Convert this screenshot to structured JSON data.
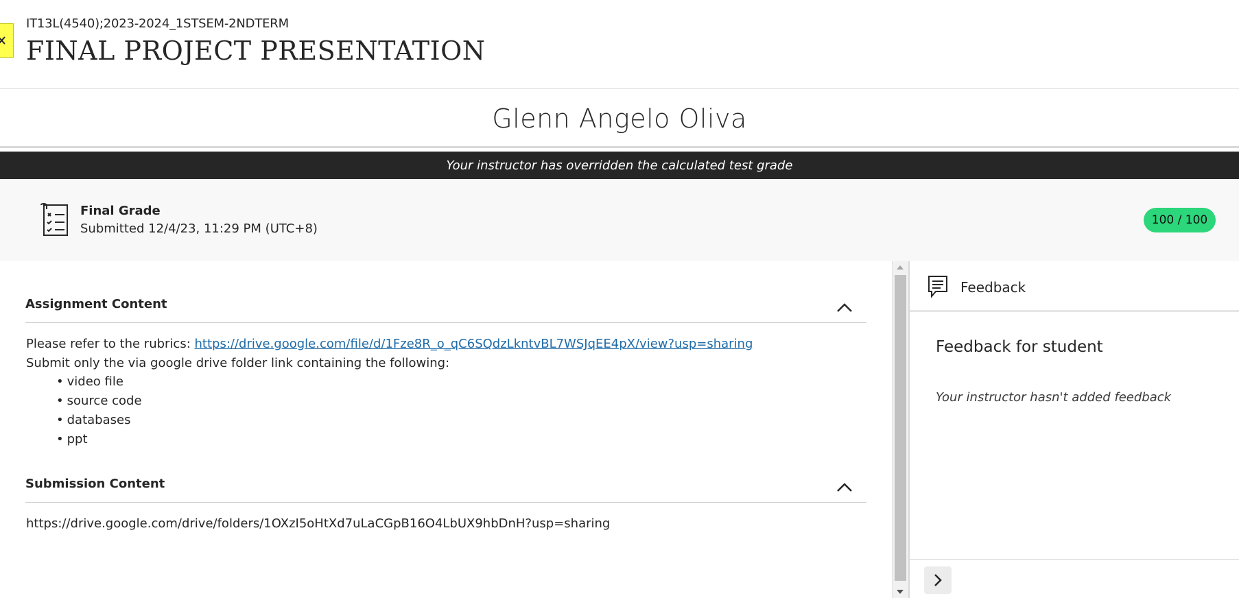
{
  "header": {
    "course_id": "IT13L(4540);2023-2024_1STSEM-2NDTERM",
    "title": "FINAL PROJECT PRESENTATION",
    "close_icon": "close-x-icon"
  },
  "student": {
    "name": "Glenn Angelo Oliva"
  },
  "banner": {
    "text": "Your instructor has overridden the calculated test grade"
  },
  "grade": {
    "icon": "checklist-icon",
    "label": "Final Grade",
    "submitted": "Submitted 12/4/23, 11:29 PM (UTC+8)",
    "score": "100 / 100",
    "score_color": "#2cd67b"
  },
  "assignment": {
    "heading": "Assignment Content",
    "rubric_prefix": "Please refer to the rubrics: ",
    "rubric_link": "https://drive.google.com/file/d/1Fze8R_o_qC6SQdzLkntvBL7WSJqEE4pX/view?usp=sharing",
    "instruction": "Submit only the via google drive folder link containing the following:",
    "items": [
      "video file",
      "source code",
      "databases",
      "ppt"
    ]
  },
  "submission": {
    "heading": "Submission Content",
    "link_text": "https://drive.google.com/drive/folders/1OXzI5oHtXd7uLaCGpB16O4LbUX9hbDnH?usp=sharing"
  },
  "feedback": {
    "icon": "feedback-icon",
    "title": "Feedback",
    "subtitle": "Feedback for student",
    "empty_text": "Your instructor hasn't added feedback",
    "next_icon": "chevron-right-icon"
  },
  "colors": {
    "banner_bg": "#262626",
    "link": "#1f6ba8",
    "close_tab": "#ffff4d"
  }
}
